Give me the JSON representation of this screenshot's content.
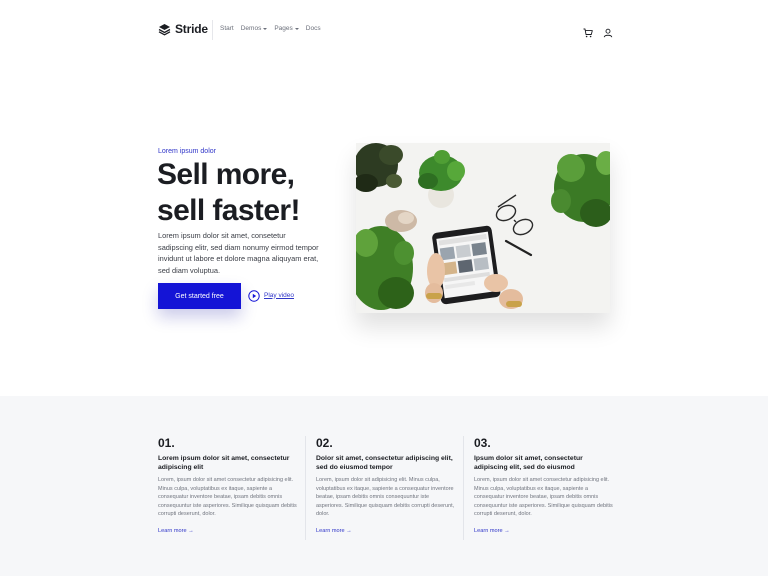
{
  "brand": {
    "name": "Stride"
  },
  "nav": {
    "links": [
      {
        "label": "Start",
        "dropdown": false
      },
      {
        "label": "Demos",
        "dropdown": true
      },
      {
        "label": "Pages",
        "dropdown": true
      },
      {
        "label": "Docs",
        "dropdown": false
      }
    ],
    "icons": [
      "cart-icon",
      "user-icon"
    ]
  },
  "hero": {
    "eyebrow": "Lorem ipsum dolor",
    "title_line1": "Sell more,",
    "title_line2": "sell faster!",
    "description": "Lorem ipsum dolor sit amet, consetetur sadipscing elitr, sed diam nonumy eirmod tempor invidunt ut labore et dolore magna aliquyam erat, sed diam voluptua.",
    "cta_label": "Get started free",
    "play_label": "Play video"
  },
  "features": [
    {
      "number": "01.",
      "title": "Lorem ipsum dolor sit amet, consectetur adipiscing elit",
      "body": "Lorem, ipsum dolor sit amet consectetur adipisicing elit. Minus culpa, voluptatibus ex itaque, sapiente a consequatur inventore beatae, ipsam debitis omnis consequuntur iste asperiores. Similique quisquam debitis corrupti deserunt, dolor.",
      "link": "Learn more →"
    },
    {
      "number": "02.",
      "title": "Dolor sit amet, consectetur adipiscing elit, sed do eiusmod tempor",
      "body": "Lorem, ipsum dolor sit adipisicing elit. Minus culpa, voluptatibus ex itaque, sapiente a consequatur inventore beatae, ipsam debitis omnis consequuntur iste asperiores. Similique quisquam debitis corrupti deserunt, dolor.",
      "link": "Learn more →"
    },
    {
      "number": "03.",
      "title": "Ipsum dolor sit amet, consectetur adipiscing elit, sed do eiusmod",
      "body": "Lorem, ipsum dolor sit amet consectetur adipisicing elit. Minus culpa, voluptatibus ex itaque, sapiente a consequatur inventore beatae, ipsam debitis omnis consequuntur iste asperiores. Similique quisquam debitis corrupti deserunt, dolor.",
      "link": "Learn more →"
    }
  ],
  "colors": {
    "accent": "#1414d6",
    "link": "#2f35c8",
    "text": "#1b1d22",
    "muted": "#70747e",
    "section_bg": "#f6f7f9"
  }
}
